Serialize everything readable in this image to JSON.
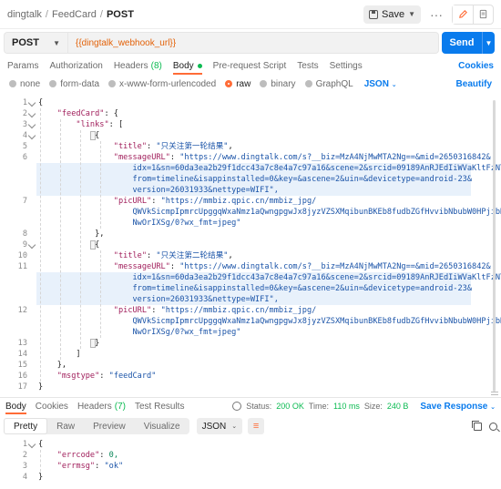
{
  "breadcrumb": {
    "collection": "dingtalk",
    "folder": "FeedCard",
    "request": "POST"
  },
  "header": {
    "save_label": "Save"
  },
  "request": {
    "method": "POST",
    "url": "{{dingtalk_webhook_url}}",
    "send_label": "Send"
  },
  "req_tabs": [
    {
      "label": "Params"
    },
    {
      "label": "Authorization"
    },
    {
      "label": "Headers",
      "count": "(8)"
    },
    {
      "label": "Body",
      "active": true
    },
    {
      "label": "Pre-request Script"
    },
    {
      "label": "Tests"
    },
    {
      "label": "Settings"
    }
  ],
  "cookies_label": "Cookies",
  "body_types": [
    "none",
    "form-data",
    "x-www-form-urlencoded",
    "raw",
    "binary",
    "GraphQL"
  ],
  "body_lang": "JSON",
  "beautify_label": "Beautify",
  "request_body": {
    "feedcard_key": "\"feedCard\"",
    "links_key": "\"links\"",
    "title_key": "\"title\"",
    "title1": "\"只关注第一轮结果\"",
    "title2": "\"只关注第二轮结果\"",
    "msgurl_key": "\"messageURL\"",
    "msgurl_l1": "\"https://www.dingtalk.com/s?__biz=MzA4NjMwMTA2Ng==&mid=2650316842&",
    "msgurl_l2": "idx=1&sn=60da3ea2b29f1dcc43a7c8e4a7c97a16&scene=2&srcid=09189AnRJEdIiWVaKltFzNTw&",
    "msgurl_l3": "from=timeline&isappinstalled=0&key=&ascene=2&uin=&devicetype=android-23&",
    "msgurl_l4": "version=26031933&nettype=WIFI\",",
    "picurl_key": "\"picURL\"",
    "picurl_l1": "\"https://mmbiz.qpic.cn/mmbiz_jpg/",
    "picurl_l2": "QWVkSicmpIpmrcUpggqWxaNmz1aQwngpgwJx8jyzVZSXMqibunBKEb8fudbZGfHvvibNbubW0HPjibHgHib",
    "picurl_l3": "NwOrIXSg/0?wx_fmt=jpeg\"",
    "msgtype_key": "\"msgtype\"",
    "msgtype_val": "\"feedCard\""
  },
  "line_numbers": [
    "1",
    "2",
    "3",
    "4",
    "5",
    "6",
    "",
    "",
    "",
    "7",
    "",
    "",
    "8",
    "9",
    "10",
    "11",
    "",
    "",
    "",
    "12",
    "",
    "13",
    "14",
    "15",
    "16",
    "17"
  ],
  "resp_tabs": [
    {
      "label": "Body",
      "active": true
    },
    {
      "label": "Cookies"
    },
    {
      "label": "Headers",
      "count": "(7)"
    },
    {
      "label": "Test Results"
    }
  ],
  "resp_meta": {
    "status_label": "Status:",
    "status_value": "200 OK",
    "time_label": "Time:",
    "time_value": "110 ms",
    "size_label": "Size:",
    "size_value": "240 B",
    "save_response": "Save Response"
  },
  "resp_views": [
    "Pretty",
    "Raw",
    "Preview",
    "Visualize"
  ],
  "resp_format": "JSON",
  "response_body": {
    "line_numbers": [
      "1",
      "2",
      "3",
      "4"
    ],
    "errcode_key": "\"errcode\"",
    "errcode_val": "0,",
    "errmsg_key": "\"errmsg\"",
    "errmsg_val": "\"ok\""
  }
}
